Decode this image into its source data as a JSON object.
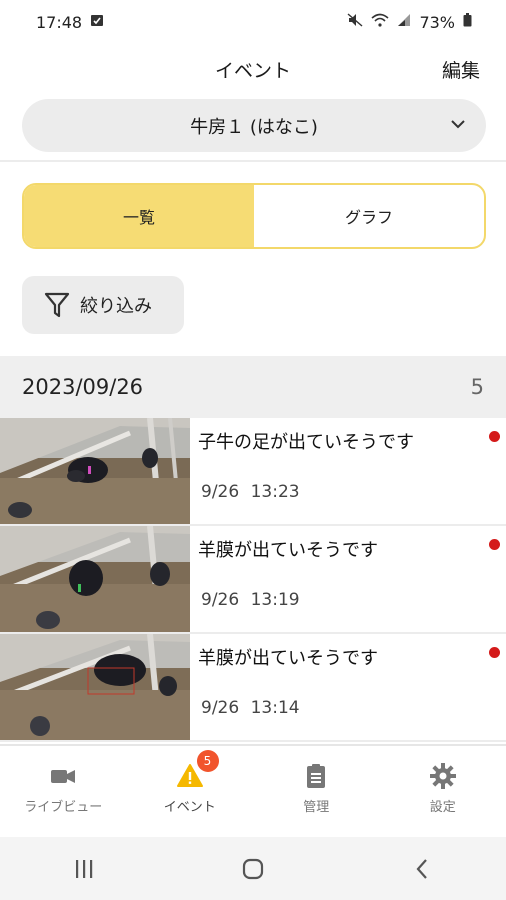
{
  "status_bar": {
    "time": "17:48",
    "battery": "73%"
  },
  "header": {
    "title": "イベント",
    "edit_label": "編集"
  },
  "barn_selector": {
    "value": "牛房１ (はなこ)",
    "icon": "chevron-down-icon"
  },
  "segments": [
    {
      "label": "一覧",
      "active": true
    },
    {
      "label": "グラフ",
      "active": false
    }
  ],
  "filter": {
    "label": "絞り込み",
    "icon": "filter-icon"
  },
  "date_group": {
    "date": "2023/09/26",
    "count": "5"
  },
  "events": [
    {
      "title": "子牛の足が出ていそうです",
      "date": "9/26",
      "time": "13:23",
      "unread": true
    },
    {
      "title": "羊膜が出ていそうです",
      "date": "9/26",
      "time": "13:19",
      "unread": true
    },
    {
      "title": "羊膜が出ていそうです",
      "date": "9/26",
      "time": "13:14",
      "unread": true
    }
  ],
  "tabbar": {
    "tabs": [
      {
        "label": "ライブビュー",
        "icon": "video-camera-icon"
      },
      {
        "label": "イベント",
        "icon": "warning-icon",
        "badge": "5",
        "active": true
      },
      {
        "label": "管理",
        "icon": "clipboard-icon"
      },
      {
        "label": "設定",
        "icon": "gear-icon"
      }
    ]
  },
  "colors": {
    "accent": "#f6dc74",
    "accent_border": "#f3d86a",
    "unread": "#d41a1a",
    "badge": "#f1542c",
    "warning": "#f5b800"
  }
}
